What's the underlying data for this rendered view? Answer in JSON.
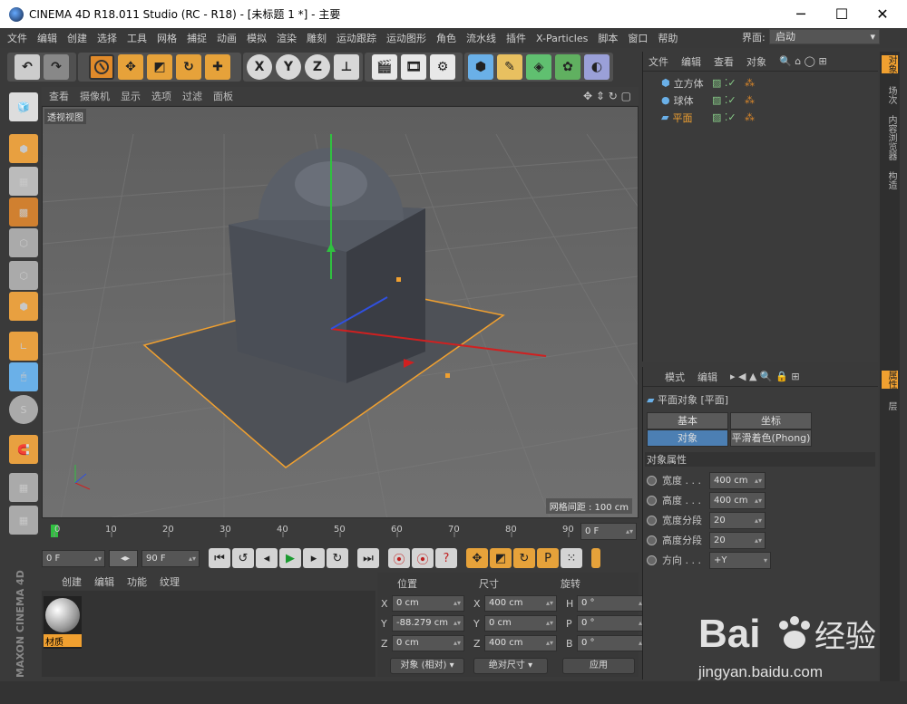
{
  "window": {
    "title": "CINEMA 4D R18.011 Studio (RC - R18) - [未标题 1 *] - 主要",
    "minimize": "─",
    "maximize": "☐",
    "close": "✕"
  },
  "menubar": [
    "文件",
    "编辑",
    "创建",
    "选择",
    "工具",
    "网格",
    "捕捉",
    "动画",
    "模拟",
    "渲染",
    "雕刻",
    "运动跟踪",
    "运动图形",
    "角色",
    "流水线",
    "插件",
    "X-Particles",
    "脚本",
    "窗口",
    "帮助"
  ],
  "layout": {
    "label": "界面:",
    "value": "启动"
  },
  "toolbar": {
    "axis_x": "X",
    "axis_y": "Y",
    "axis_z": "Z"
  },
  "viewport": {
    "menu": [
      "查看",
      "摄像机",
      "显示",
      "选项",
      "过滤",
      "面板"
    ],
    "label": "透视视图",
    "grid_readout": "网格间距 : 100 cm"
  },
  "timeline": {
    "ticks": [
      "0",
      "10",
      "20",
      "30",
      "40",
      "50",
      "60",
      "70",
      "80",
      "90"
    ],
    "current_frame": "0 F"
  },
  "transport": {
    "start": "0 F",
    "end": "90 F"
  },
  "material_panel": {
    "menu": [
      "创建",
      "编辑",
      "功能",
      "纹理"
    ],
    "material_name": "材质"
  },
  "coord_panel": {
    "headers": [
      "位置",
      "尺寸",
      "旋转"
    ],
    "rows": [
      {
        "pl": "X",
        "pv": "0 cm",
        "sl": "X",
        "sv": "400 cm",
        "rl": "H",
        "rv": "0 °"
      },
      {
        "pl": "Y",
        "pv": "-88.279 cm",
        "sl": "Y",
        "sv": "0 cm",
        "rl": "P",
        "rv": "0 °"
      },
      {
        "pl": "Z",
        "pv": "0 cm",
        "sl": "Z",
        "sv": "400 cm",
        "rl": "B",
        "rv": "0 °"
      }
    ],
    "mode": "对象 (相对)",
    "size_mode": "绝对尺寸",
    "apply": "应用"
  },
  "object_manager": {
    "menu": [
      "文件",
      "编辑",
      "查看",
      "对象"
    ],
    "objects": [
      "立方体",
      "球体",
      "平面"
    ]
  },
  "attribute_manager": {
    "menu": [
      "模式",
      "编辑"
    ],
    "object_title": "平面对象 [平面]",
    "tabs": [
      "基本",
      "坐标",
      "对象",
      "平滑着色(Phong)"
    ],
    "section": "对象属性",
    "props": [
      {
        "label": "宽度 . . .",
        "value": "400 cm"
      },
      {
        "label": "高度 . . .",
        "value": "400 cm"
      },
      {
        "label": "宽度分段",
        "value": "20"
      },
      {
        "label": "高度分段",
        "value": "20"
      },
      {
        "label": "方向 . . .",
        "value": "+Y"
      }
    ]
  },
  "right_tabs": [
    "对象",
    "场次",
    "内容浏览器",
    "构造",
    "属性",
    "层"
  ],
  "branding": {
    "maxon": "MAXON CINEMA 4D"
  },
  "watermark": {
    "site": "jingyan.baidu.com"
  },
  "colors": {
    "accent": "#f0a030",
    "active_tab": "#4c7fb3",
    "bg": "#3a3a3a"
  }
}
